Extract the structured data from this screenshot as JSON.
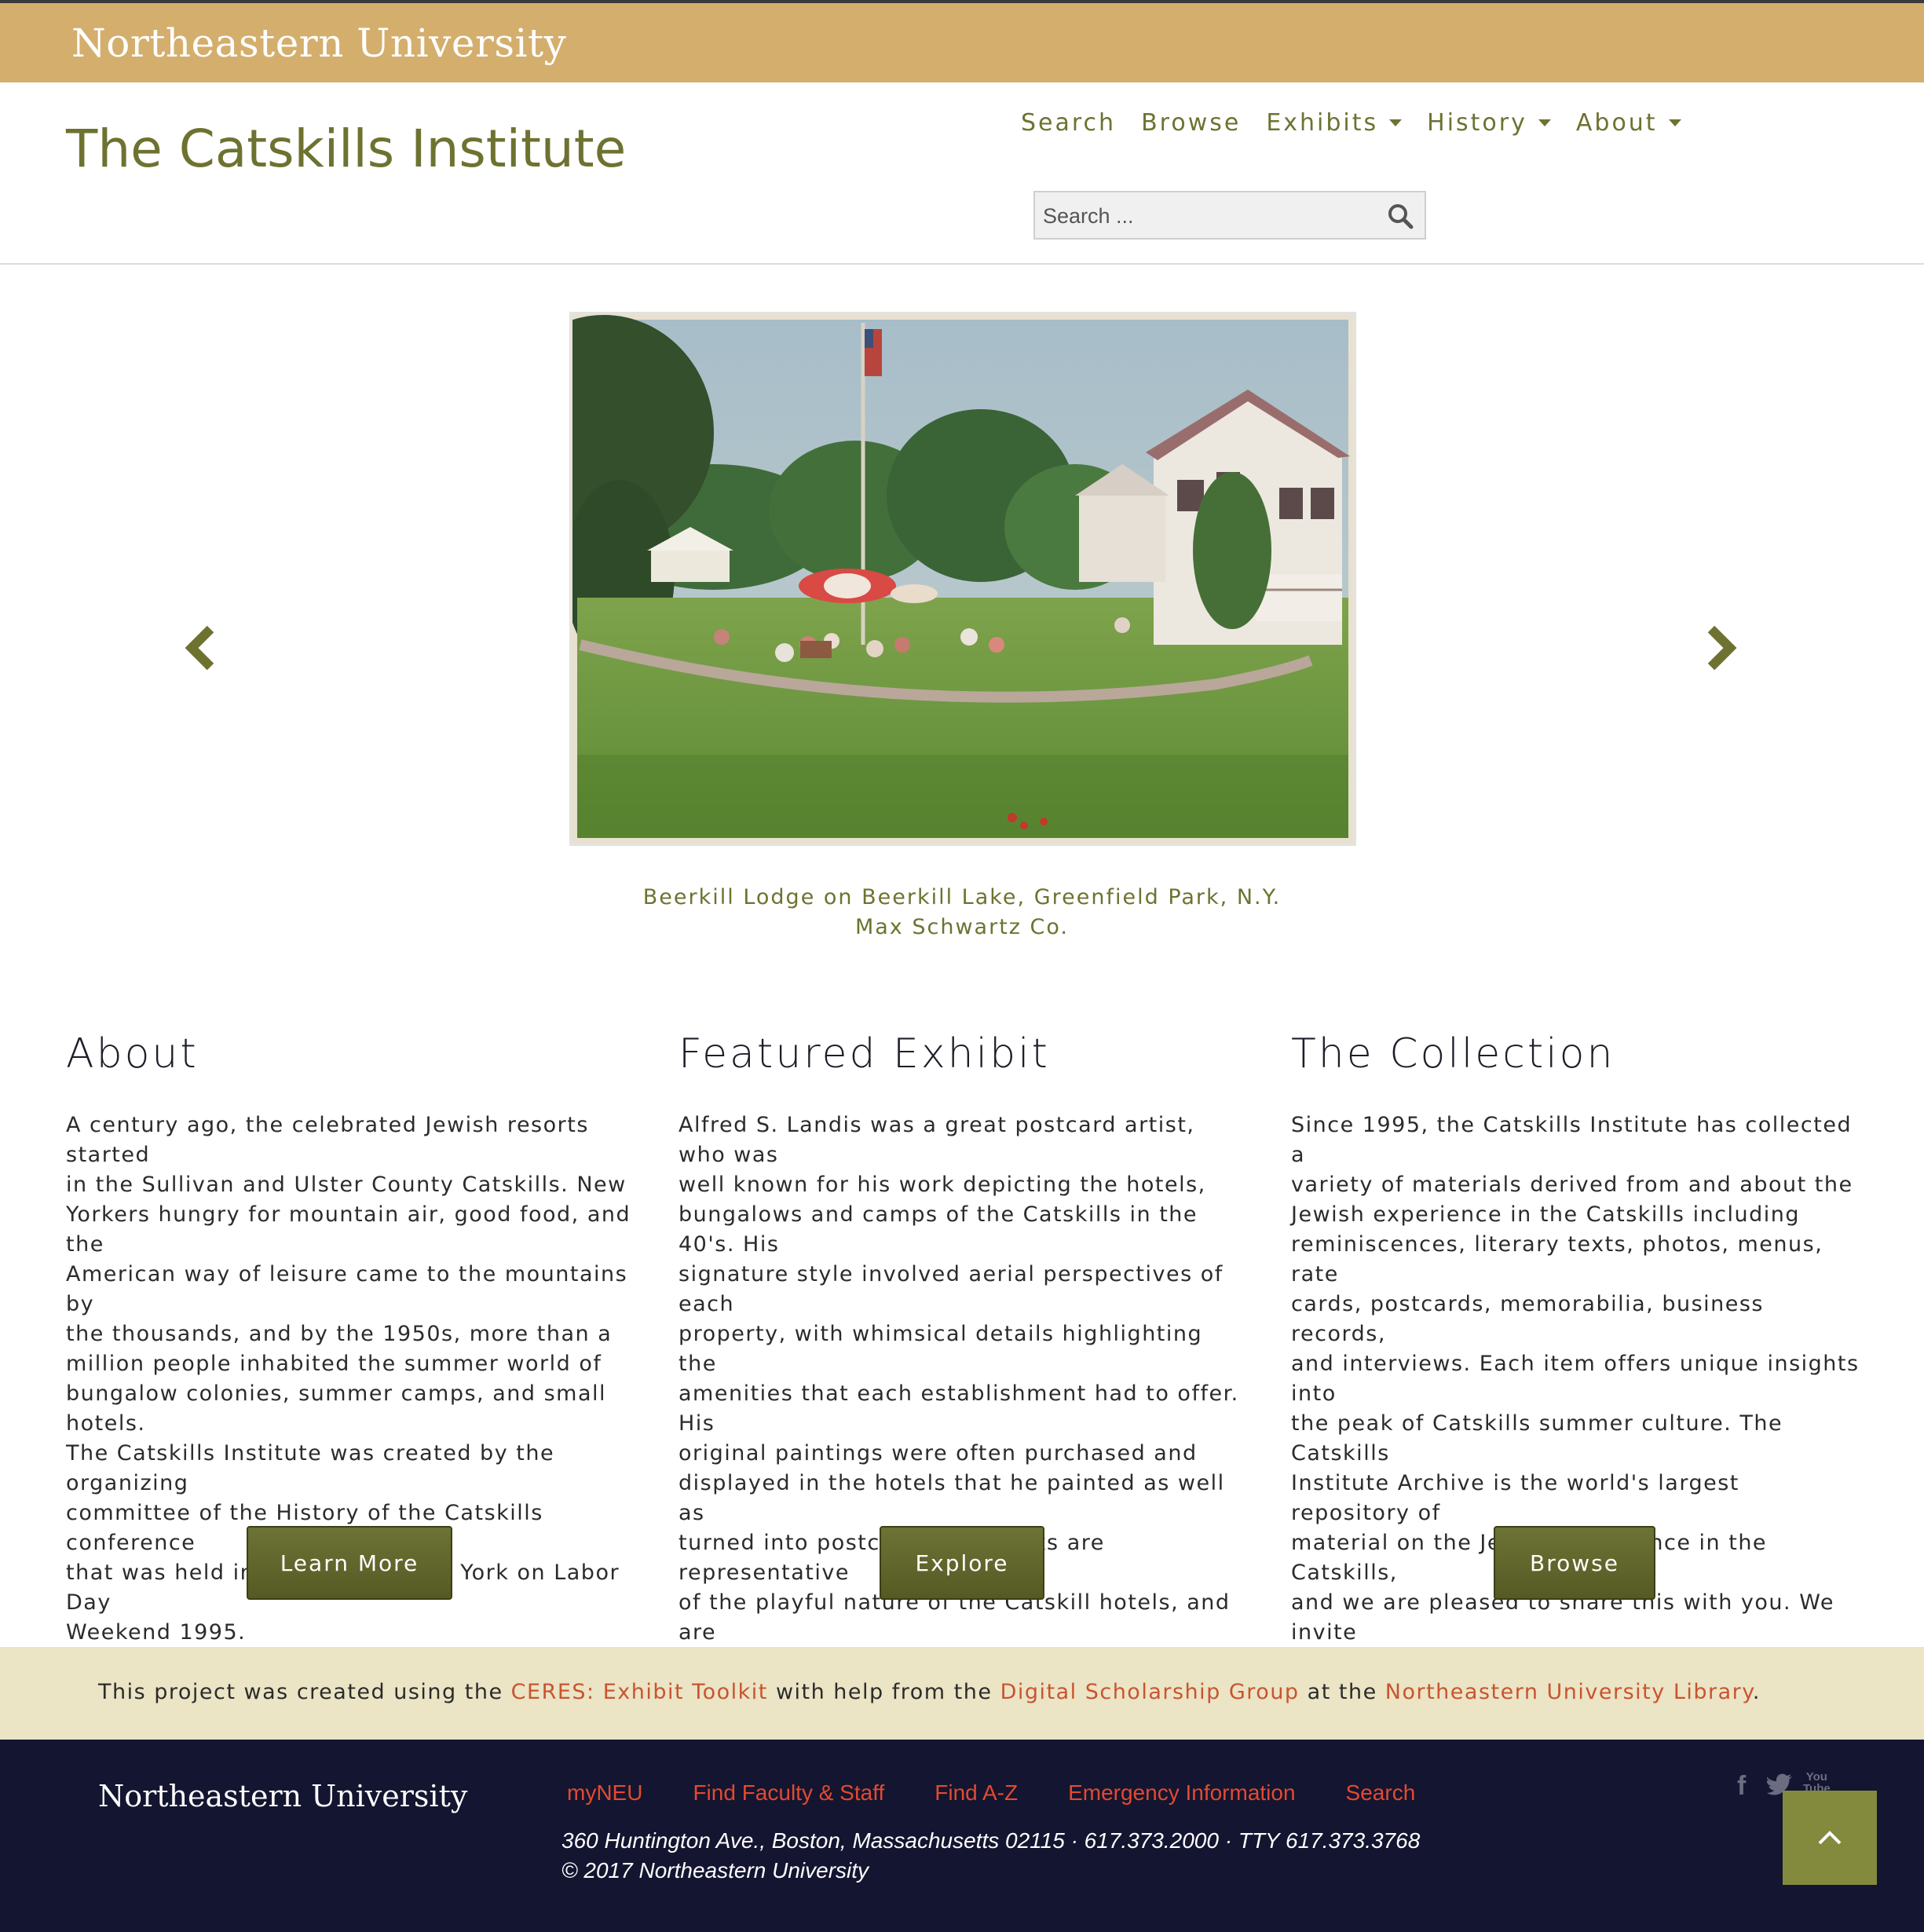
{
  "topbar": {
    "university": "Northeastern University"
  },
  "header": {
    "site_title": "The Catskills Institute",
    "nav": {
      "search": "Search",
      "browse": "Browse",
      "exhibits": "Exhibits",
      "history": "History",
      "about": "About"
    },
    "search": {
      "placeholder": "Search ..."
    }
  },
  "carousel": {
    "caption_line1": "Beerkill Lodge on Beerkill Lake, Greenfield Park, N.Y.",
    "caption_line2": "Max Schwartz Co."
  },
  "columns": [
    {
      "heading": "About",
      "text": "A century ago, the celebrated Jewish resorts started\nin the Sullivan and Ulster County Catskills. New\nYorkers hungry for mountain air, good food, and the\nAmerican way of leisure came to the mountains by\nthe thousands, and by the 1950s, more than a\nmillion people inhabited the summer world of\nbungalow colonies, summer camps, and small hotels.\nThe Catskills Institute was created by the organizing\ncommittee of the History of the Catskills conference\nthat was held in Woodridge, New York on Labor Day\nWeekend 1995.",
      "button": "Learn More"
    },
    {
      "heading": "Featured Exhibit",
      "text": "Alfred S. Landis was a great postcard artist, who was\nwell known for his work depicting the hotels,\nbungalows and camps of the Catskills in the 40's. His\nsignature style involved aerial perspectives of each\nproperty, with whimsical details highlighting the\namenities that each establishment had to offer. His\noriginal paintings were often purchased and\ndisplayed in the hotels that he painted as well as\nturned into postcards. His works are representative\nof the playful nature of the Catskill hotels, and are\npopular items for collectors today.",
      "button": "Explore"
    },
    {
      "heading": "The Collection",
      "text": "Since 1995, the Catskills Institute has collected a\nvariety of materials derived from and about the\nJewish experience in the Catskills including\nreminiscences, literary texts, photos, menus, rate\ncards, postcards, memorabilia, business records,\nand interviews. Each item offers unique insights into\nthe peak of Catskills summer culture. The Catskills\nInstitute Archive is the world's largest repository of\nmaterial on the Jewish experience in the Catskills,\nand we are pleased to share this with you. We invite\nyou to explore our collection at your leisure.",
      "button": "Browse"
    }
  ],
  "credits": {
    "prefix": "This project was created using the ",
    "link1": "CERES: Exhibit Toolkit",
    "middle1": " with help from the ",
    "link2": "Digital Scholarship Group",
    "middle2": " at the ",
    "link3": "Northeastern University Library",
    "suffix": "."
  },
  "footer": {
    "logo": "Northeastern University",
    "links": [
      "myNEU",
      "Find Faculty & Staff",
      "Find A-Z",
      "Emergency Information",
      "Search"
    ],
    "address": "360 Huntington Ave., Boston, Massachusetts 02115 · 617.373.2000 · TTY 617.373.3768",
    "copyright": "© 2017 Northeastern University",
    "social": {
      "facebook": "f",
      "youtube_line1": "You",
      "youtube_line2": "Tube"
    }
  },
  "colors": {
    "gold": "#d4ae6c",
    "olive": "#6e7230",
    "link_red": "#c9542f",
    "footer_navy": "#141530"
  }
}
